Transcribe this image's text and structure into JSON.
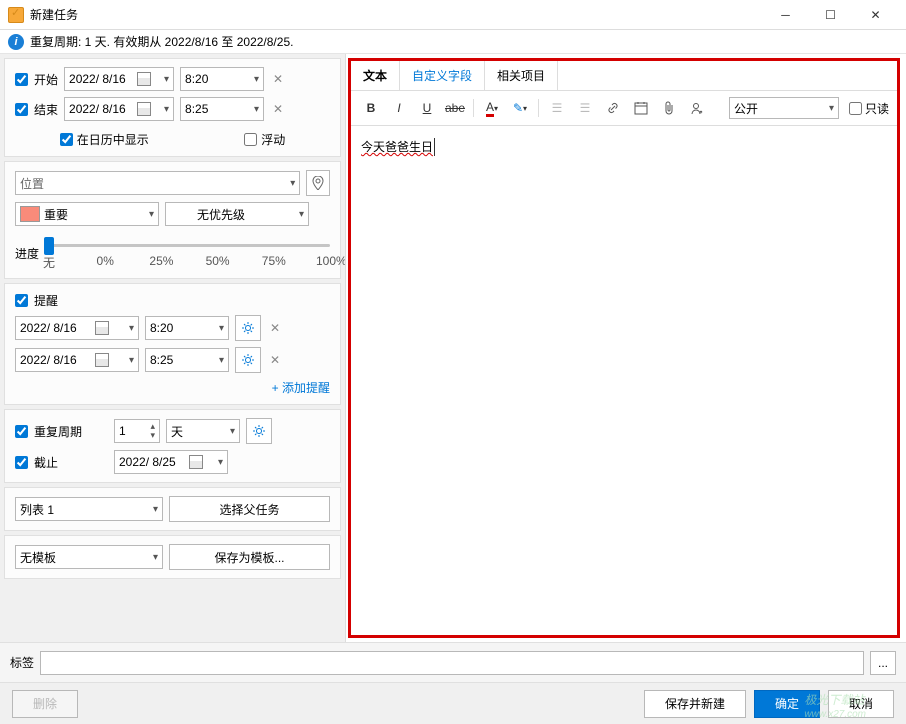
{
  "window": {
    "title": "新建任务"
  },
  "info": {
    "text": "重复周期: 1 天. 有效期从 2022/8/16 至 2022/8/25."
  },
  "dates": {
    "start_label": "开始",
    "start_date": "2022/ 8/16",
    "start_time": "8:20",
    "end_label": "结束",
    "end_date": "2022/ 8/16",
    "end_time": "8:25",
    "show_in_cal": "在日历中显示",
    "floating": "浮动"
  },
  "location": {
    "placeholder": "位置"
  },
  "category": {
    "label": "重要"
  },
  "priority": {
    "label": "无优先级"
  },
  "progress": {
    "label": "进度",
    "ticks": [
      "无",
      "0%",
      "25%",
      "50%",
      "75%",
      "100%"
    ]
  },
  "reminder": {
    "label": "提醒",
    "r1_date": "2022/ 8/16",
    "r1_time": "8:20",
    "r2_date": "2022/ 8/16",
    "r2_time": "8:25",
    "add": "+ 添加提醒"
  },
  "recur": {
    "label": "重复周期",
    "count": "1",
    "unit": "天",
    "deadline_label": "截止",
    "deadline_date": "2022/ 8/25"
  },
  "list": {
    "value": "列表 1",
    "parent_btn": "选择父任务"
  },
  "template": {
    "value": "无模板",
    "save_btn": "保存为模板..."
  },
  "tabs": {
    "text": "文本",
    "custom": "自定义字段",
    "related": "相关项目"
  },
  "visibility": {
    "value": "公开",
    "readonly": "只读"
  },
  "editor": {
    "content": "今天爸爸生日"
  },
  "tags": {
    "label": "标签"
  },
  "footer": {
    "delete": "删除",
    "save_new": "保存并新建",
    "ok": "确定",
    "cancel": "取消"
  },
  "watermark": {
    "t1": "极光下载站",
    "t2": "www.x27.com"
  }
}
